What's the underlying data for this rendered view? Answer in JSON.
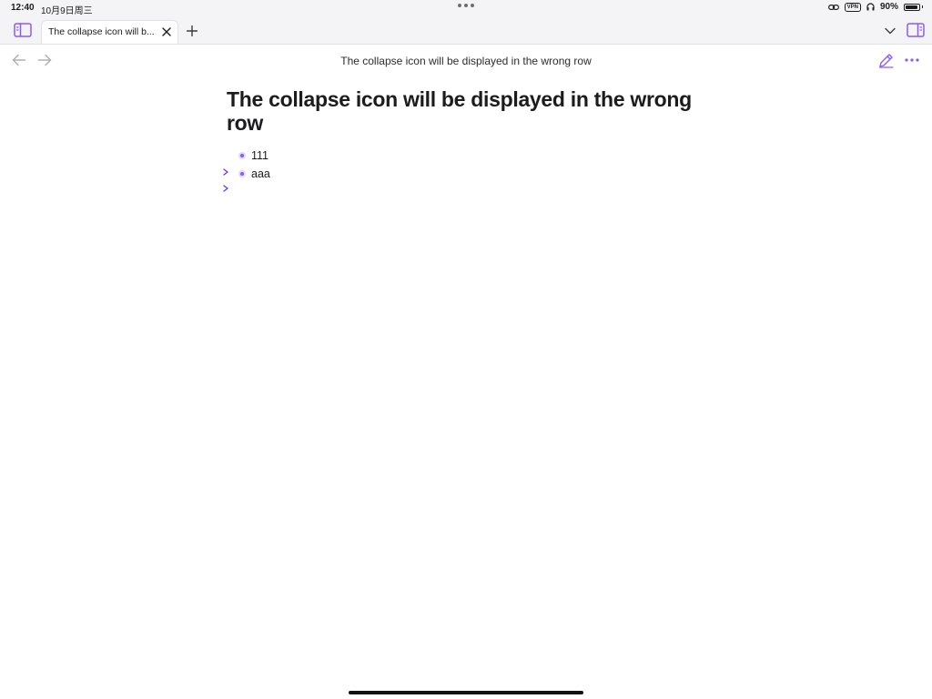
{
  "status_bar": {
    "time": "12:40",
    "date": "10月9日周三",
    "vpn_label": "VPN",
    "battery_text": "90%",
    "battery_level": 0.9
  },
  "tab": {
    "title": "The collapse icon will b..."
  },
  "nav": {
    "title": "The collapse icon will be displayed in the wrong row"
  },
  "document": {
    "title": "The collapse icon will be displayed in the wrong row",
    "items": [
      {
        "text": "111"
      },
      {
        "text": "aaa"
      }
    ]
  },
  "colors": {
    "accent": "#8a5cf5",
    "chrome_bg": "#f4f4f6"
  },
  "icons": {
    "sidebar_toggle": "sidebar-left-icon",
    "close_tab": "close-icon",
    "new_tab": "plus-icon",
    "tab_list": "chevron-down-icon",
    "right_panel": "sidebar-right-icon",
    "back": "arrow-left-icon",
    "forward": "arrow-right-icon",
    "edit": "pencil-icon",
    "more": "more-horizontal-icon",
    "collapse": "chevron-right-icon"
  }
}
